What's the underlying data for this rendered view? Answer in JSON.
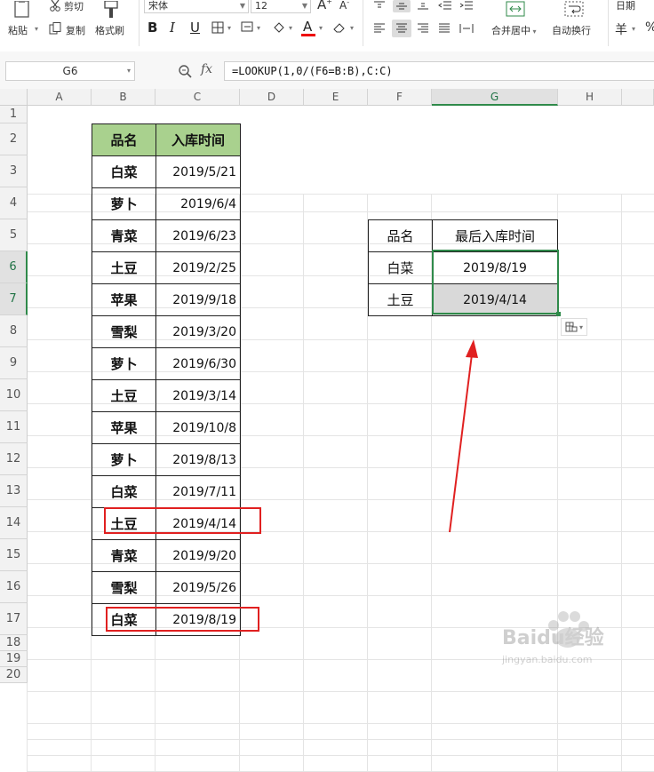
{
  "ribbon": {
    "paste": "粘贴",
    "cut": "剪切",
    "copy": "复制",
    "format_painter": "格式刷",
    "font_name": "宋体",
    "font_size": "12",
    "merge_center": "合并居中",
    "wrap_text": "自动换行",
    "number_format": "日期",
    "currency_symbol": "羊",
    "percent_symbol": "%"
  },
  "formula_bar": {
    "name_box": "G6",
    "fx": "fx",
    "formula": "=LOOKUP(1,0/(F6=B:B),C:C)"
  },
  "columns": [
    "A",
    "B",
    "C",
    "D",
    "E",
    "F",
    "G",
    "H"
  ],
  "rows": [
    "1",
    "2",
    "3",
    "4",
    "5",
    "6",
    "7",
    "8",
    "9",
    "10",
    "11",
    "12",
    "13",
    "14",
    "15",
    "16",
    "17",
    "18",
    "19",
    "20"
  ],
  "source_table": {
    "headers": [
      "品名",
      "入库时间"
    ],
    "rows": [
      [
        "白菜",
        "2019/5/21"
      ],
      [
        "萝卜",
        "2019/6/4"
      ],
      [
        "青菜",
        "2019/6/23"
      ],
      [
        "土豆",
        "2019/2/25"
      ],
      [
        "苹果",
        "2019/9/18"
      ],
      [
        "雪梨",
        "2019/3/20"
      ],
      [
        "萝卜",
        "2019/6/30"
      ],
      [
        "土豆",
        "2019/3/14"
      ],
      [
        "苹果",
        "2019/10/8"
      ],
      [
        "萝卜",
        "2019/8/13"
      ],
      [
        "白菜",
        "2019/7/11"
      ],
      [
        "土豆",
        "2019/4/14"
      ],
      [
        "青菜",
        "2019/9/20"
      ],
      [
        "雪梨",
        "2019/5/26"
      ],
      [
        "白菜",
        "2019/8/19"
      ]
    ]
  },
  "result_table": {
    "headers": [
      "品名",
      "最后入库时间"
    ],
    "rows": [
      [
        "白菜",
        "2019/8/19"
      ],
      [
        "土豆",
        "2019/4/14"
      ]
    ]
  },
  "watermark": "Baidu经验 jingyan.baidu.com",
  "colors": {
    "header_fill": "#a9d18e",
    "selection": "#2f8a4a",
    "annotation": "#e02020",
    "selected_fill": "#d9d9d9"
  }
}
